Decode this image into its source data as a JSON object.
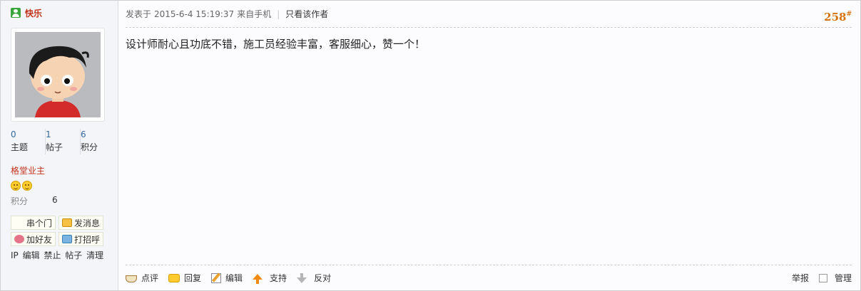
{
  "author": {
    "name": "快乐",
    "stats": [
      {
        "value": "0",
        "label": "主题"
      },
      {
        "value": "1",
        "label": "帖子"
      },
      {
        "value": "6",
        "label": "积分"
      }
    ],
    "group": "格堂业主",
    "points_label": "积分",
    "points_value": "6"
  },
  "side_buttons": {
    "chuan": "串个门",
    "message": "发消息",
    "add_friend": "加好友",
    "greet": "打招呼"
  },
  "admin_links": [
    "IP",
    "编辑",
    "禁止",
    "帖子",
    "清理"
  ],
  "post": {
    "posted_prefix": "发表于",
    "posted_time": "2015-6-4 15:19:37",
    "source": "来自手机",
    "only_author": "只看该作者",
    "floor": "258",
    "floor_mark": "#",
    "content": "设计师耐心且功底不错，施工员经验丰富，客服细心，赞一个！"
  },
  "actions": {
    "comment": "点评",
    "reply": "回复",
    "edit": "编辑",
    "support": "支持",
    "oppose": "反对",
    "report": "举报",
    "manage": "管理"
  },
  "colors": {
    "username": "#c3321b",
    "floor": "#d5720e",
    "stat_number": "#336699",
    "support_arrow": "#f08a12"
  }
}
